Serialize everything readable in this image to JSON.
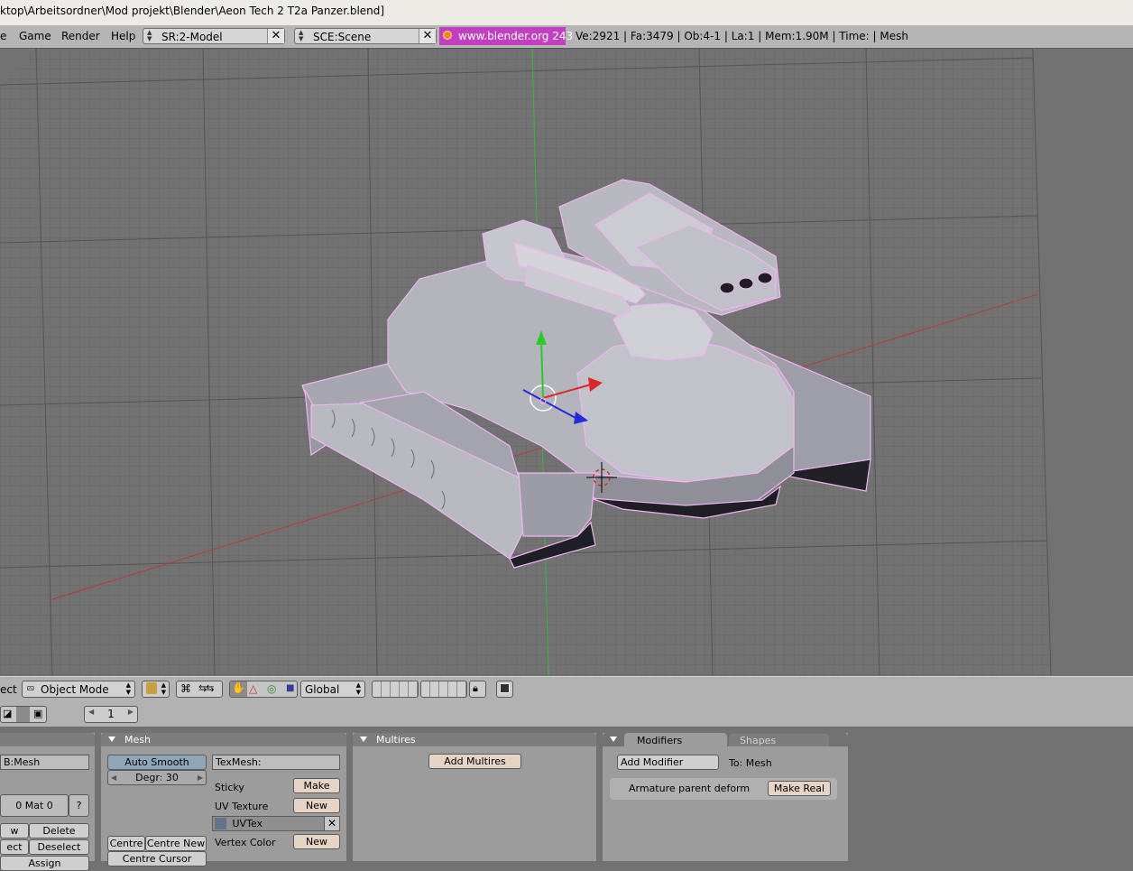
{
  "window": {
    "title": "ktop\\Arbeitsordner\\Mod projekt\\Blender\\Aeon Tech 2 T2a Panzer.blend]"
  },
  "info_header": {
    "menus": [
      "e",
      "Game",
      "Render",
      "Help"
    ],
    "screen_selector": "SR:2-Model",
    "scene_selector": "SCE:Scene",
    "logo_text": "www.blender.org 243",
    "stats": "Ve:2921 | Fa:3479 | Ob:4-1 | La:1 | Mem:1.90M | Time: | Mesh"
  },
  "view3d_header": {
    "menu_fragment": "ect",
    "mode": "Object Mode",
    "orientation": "Global"
  },
  "buttons_header": {
    "frame_value": "1"
  },
  "panels": {
    "link": {
      "mesh_name": "B:Mesh",
      "material": "0 Mat 0",
      "help": "?",
      "buttons": [
        "w",
        "Delete",
        "ect",
        "Deselect",
        "Assign"
      ]
    },
    "mesh": {
      "title": "Mesh",
      "auto_smooth": "Auto Smooth",
      "degr": "Degr: 30",
      "texmesh": "TexMesh:",
      "sticky": "Sticky",
      "make": "Make",
      "uv_texture": "UV Texture",
      "new1": "New",
      "uvtex": "UVTex",
      "vertex_color": "Vertex Color",
      "new2": "New",
      "centre": "Centre",
      "centre_new": "Centre New",
      "centre_cursor": "Centre Cursor"
    },
    "multires": {
      "title": "Multires",
      "add_multires": "Add Multires"
    },
    "modifiers": {
      "tab_modifiers": "Modifiers",
      "tab_shapes": "Shapes",
      "add_modifier": "Add Modifier",
      "to_mesh": "To: Mesh",
      "armature_label": "Armature parent deform",
      "make_real": "Make Real"
    }
  },
  "colors": {
    "logo_bg": "#c13fc0",
    "selection_outline": "#f0b4f0",
    "x_axis": "#c83232",
    "y_axis": "#32c832"
  }
}
